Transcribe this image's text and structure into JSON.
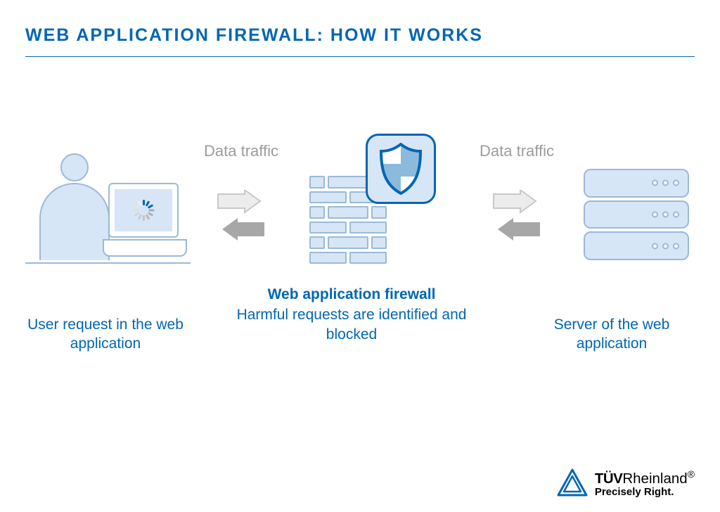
{
  "title": "WEB APPLICATION FIREWALL: HOW IT WORKS",
  "arrows": {
    "label_left": "Data traffic",
    "label_right": "Data traffic"
  },
  "captions": {
    "user": "User request in the web application",
    "waf_title": "Web application firewall",
    "waf_body": "Harmful requests are identified and blocked",
    "server": "Server of the web application"
  },
  "logo": {
    "brand_bold": "TÜV",
    "brand_rest": "Rheinland",
    "registered": "®",
    "tagline": "Precisely Right."
  },
  "colors": {
    "primary": "#0066b3",
    "light_fill": "#d6e6f6",
    "light_stroke": "#9bb9d9",
    "grey_text": "#9c9c9c",
    "arrow_light_fill": "#ececec",
    "arrow_light_stroke": "#c8c8c8",
    "arrow_dark": "#a7a7a7"
  }
}
